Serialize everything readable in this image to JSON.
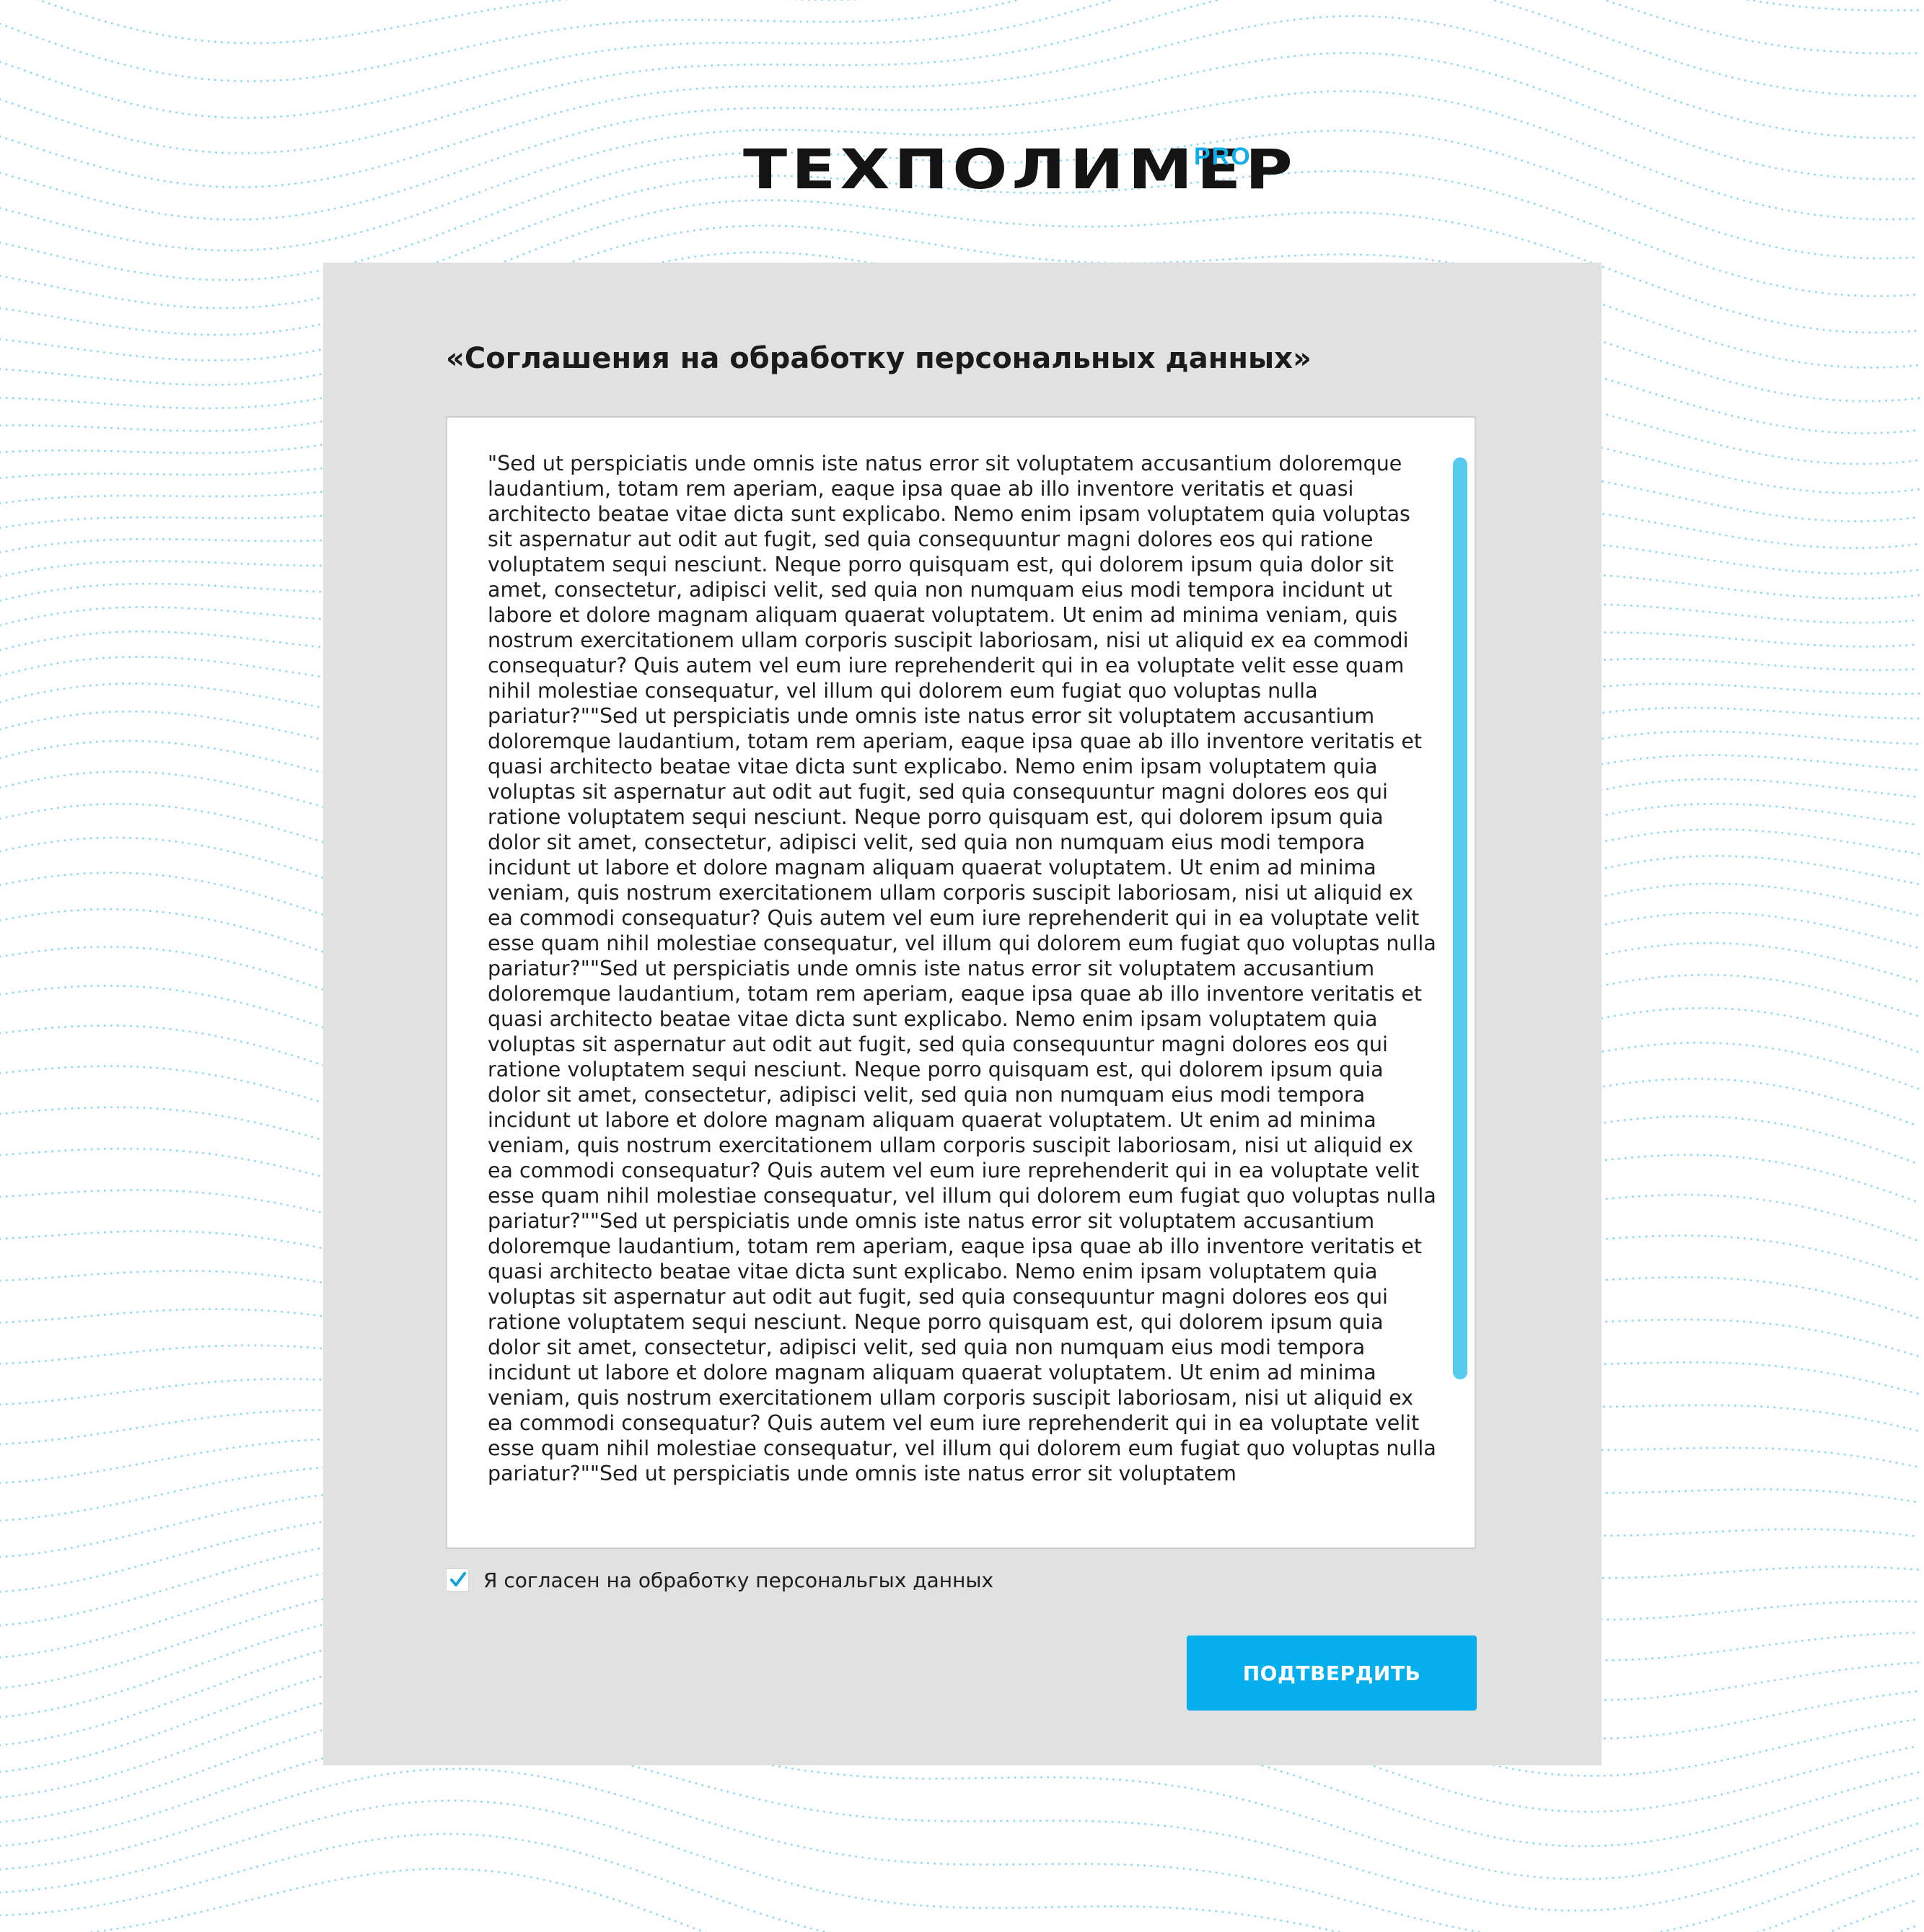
{
  "brand": {
    "name": "ТЕХПОЛИМЕР",
    "suffix": "PRO",
    "accent_color": "#05aeec"
  },
  "dialog": {
    "title": "«Соглашения на обработку персональных данных»",
    "agreement_text": "\"Sed ut perspiciatis unde omnis iste natus error sit voluptatem accusantium doloremque laudantium, totam rem aperiam, eaque ipsa quae ab illo inventore veritatis et quasi architecto beatae vitae dicta sunt explicabo. Nemo enim ipsam voluptatem quia voluptas sit aspernatur aut odit aut fugit, sed quia consequuntur magni dolores eos qui ratione voluptatem sequi nesciunt. Neque porro quisquam est, qui dolorem ipsum quia dolor sit amet, consectetur, adipisci velit, sed quia non numquam eius modi tempora incidunt ut labore et dolore magnam aliquam quaerat voluptatem. Ut enim ad minima veniam, quis nostrum exercitationem ullam corporis suscipit laboriosam, nisi ut aliquid ex ea commodi consequatur? Quis autem vel eum iure reprehenderit qui in ea voluptate velit esse quam nihil molestiae consequatur, vel illum qui dolorem eum fugiat quo voluptas nulla pariatur?\"\"Sed ut perspiciatis unde omnis iste natus error sit voluptatem accusantium doloremque laudantium, totam rem aperiam, eaque ipsa quae ab illo inventore veritatis et quasi architecto beatae vitae dicta sunt explicabo. Nemo enim ipsam voluptatem quia voluptas sit aspernatur aut odit aut fugit, sed quia consequuntur magni dolores eos qui ratione voluptatem sequi nesciunt. Neque porro quisquam est, qui dolorem ipsum quia dolor sit amet, consectetur, adipisci velit, sed quia non numquam eius modi tempora incidunt ut labore et dolore magnam aliquam quaerat voluptatem. Ut enim ad minima veniam, quis nostrum exercitationem ullam corporis suscipit laboriosam, nisi ut aliquid ex ea commodi consequatur? Quis autem vel eum iure reprehenderit qui in ea voluptate velit esse quam nihil molestiae consequatur, vel illum qui dolorem eum fugiat quo voluptas nulla pariatur?\"\"Sed ut perspiciatis unde omnis iste natus error sit voluptatem accusantium doloremque laudantium, totam rem aperiam, eaque ipsa quae ab illo inventore veritatis et quasi architecto beatae vitae dicta sunt explicabo. Nemo enim ipsam voluptatem quia voluptas sit aspernatur aut odit aut fugit, sed quia consequuntur magni dolores eos qui ratione voluptatem sequi nesciunt. Neque porro quisquam est, qui dolorem ipsum quia dolor sit amet, consectetur, adipisci velit, sed quia non numquam eius modi tempora incidunt ut labore et dolore magnam aliquam quaerat voluptatem. Ut enim ad minima veniam, quis nostrum exercitationem ullam corporis suscipit laboriosam, nisi ut aliquid ex ea commodi consequatur? Quis autem vel eum iure reprehenderit qui in ea voluptate velit esse quam nihil molestiae consequatur, vel illum qui dolorem eum fugiat quo voluptas nulla pariatur?\"\"Sed ut perspiciatis unde omnis iste natus error sit voluptatem accusantium doloremque laudantium, totam rem aperiam, eaque ipsa quae ab illo inventore veritatis et quasi architecto beatae vitae dicta sunt explicabo. Nemo enim ipsam voluptatem quia voluptas sit aspernatur aut odit aut fugit, sed quia consequuntur magni dolores eos qui ratione voluptatem sequi nesciunt. Neque porro quisquam est, qui dolorem ipsum quia dolor sit amet, consectetur, adipisci velit, sed quia non numquam eius modi tempora incidunt ut labore et dolore magnam aliquam quaerat voluptatem. Ut enim ad minima veniam, quis nostrum exercitationem ullam corporis suscipit laboriosam, nisi ut aliquid ex ea commodi consequatur? Quis autem vel eum iure reprehenderit qui in ea voluptate velit esse quam nihil molestiae consequatur, vel illum qui dolorem eum fugiat quo voluptas nulla pariatur?\"\"Sed ut perspiciatis unde omnis iste natus error sit voluptatem",
    "scrollbar_color": "#56cbee",
    "consent": {
      "checked": true,
      "label": "Я согласен на обработку персональгых данных"
    },
    "confirm_button_label": "ПОДТВЕРДИТЬ"
  }
}
